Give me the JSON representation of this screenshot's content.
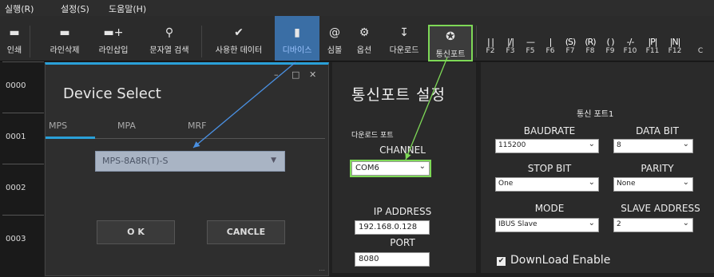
{
  "menu": [
    "실행(R)",
    "설정(S)",
    "도움말(H)"
  ],
  "toolbar": {
    "print": "인쇄",
    "delete_line": "라인삭제",
    "insert_line": "라인삽입",
    "search": "문자열 검색",
    "used_data": "사용한 데이터",
    "device": "디바이스",
    "symbol": "심볼",
    "options": "옵션",
    "download": "다운로드",
    "comm_port": "통신포트"
  },
  "fkeys": [
    {
      "glyph": "| |",
      "label": "F2"
    },
    {
      "glyph": "|/|",
      "label": "F3"
    },
    {
      "glyph": "—",
      "label": "F5"
    },
    {
      "glyph": "|",
      "label": "F6"
    },
    {
      "glyph": "(S)",
      "label": "F7"
    },
    {
      "glyph": "(R)",
      "label": "F8"
    },
    {
      "glyph": "( )",
      "label": "F9"
    },
    {
      "glyph": "-/-",
      "label": "F10"
    },
    {
      "glyph": "|P|",
      "label": "F11"
    },
    {
      "glyph": "|N|",
      "label": "F12"
    }
  ],
  "toolbar_cut_label": "C",
  "rows": [
    "0000",
    "0001",
    "0002",
    "0003"
  ],
  "device_dialog": {
    "title": "Device Select",
    "tabs": [
      "MPS",
      "MPA",
      "MRF"
    ],
    "selected_model": "MPS-8A8R(T)-S",
    "ok": "O K",
    "cancel": "CANCLE"
  },
  "comm_settings": {
    "heading": "통신포트 설정",
    "download_port": "다운로드 포트",
    "channel_label": "CHANNEL",
    "channel_value": "COM6",
    "ip_label": "IP ADDRESS",
    "ip_value": "192.168.0.128",
    "port_label": "PORT",
    "port_value": "8080"
  },
  "comm_port1": {
    "title": "통신 포트1",
    "baudrate_label": "BAUDRATE",
    "baudrate_value": "115200",
    "databit_label": "DATA BIT",
    "databit_value": "8",
    "stopbit_label": "STOP BIT",
    "stopbit_value": "One",
    "parity_label": "PARITY",
    "parity_value": "None",
    "mode_label": "MODE",
    "mode_value": "IBUS Slave",
    "slave_label": "SLAVE ADDRESS",
    "slave_value": "2",
    "download_enable": "DownLoad Enable",
    "download_enable_checked": true
  },
  "colors": {
    "accent_blue": "#2aa0d8",
    "highlight_green": "#7ed957",
    "arrow_blue": "#4a90e2"
  }
}
